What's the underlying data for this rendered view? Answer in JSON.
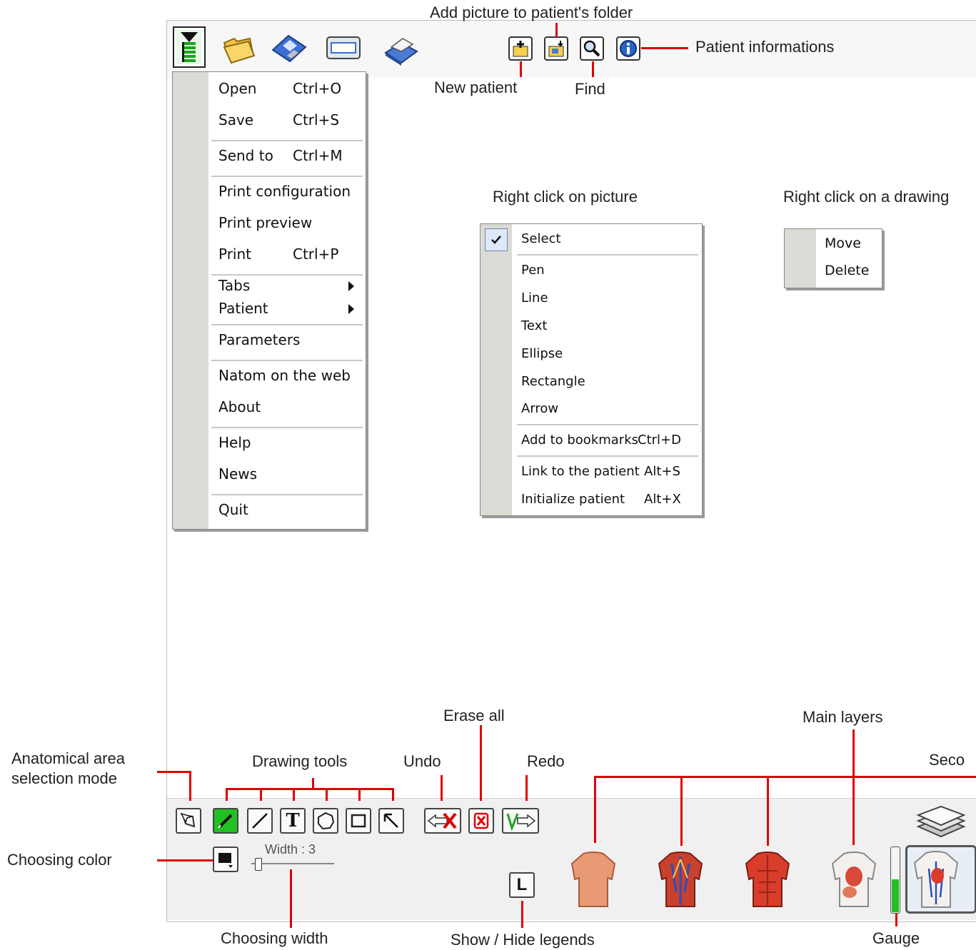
{
  "annotations": {
    "add_picture": "Add picture to patient's folder",
    "patient_info": "Patient informations",
    "new_patient": "New patient",
    "find": "Find",
    "right_click_picture": "Right click on picture",
    "right_click_drawing": "Right click on a drawing",
    "erase_all": "Erase all",
    "main_layers": "Main layers",
    "secondary_partial": "Seco",
    "anatomical_line1": "Anatomical area",
    "anatomical_line2": "selection mode",
    "drawing_tools": "Drawing tools",
    "undo": "Undo",
    "redo": "Redo",
    "choosing_color": "Choosing color",
    "choosing_width": "Choosing width",
    "show_hide_legends": "Show / Hide legends",
    "gauge": "Gauge"
  },
  "main_menu": {
    "items": [
      {
        "label": "Open",
        "shortcut": "Ctrl+O"
      },
      {
        "label": "Save",
        "shortcut": "Ctrl+S"
      },
      {
        "label": "Send to",
        "shortcut": "Ctrl+M"
      },
      {
        "label": "Print configuration",
        "shortcut": ""
      },
      {
        "label": "Print preview",
        "shortcut": ""
      },
      {
        "label": "Print",
        "shortcut": "Ctrl+P"
      },
      {
        "label": "Tabs",
        "shortcut": ""
      },
      {
        "label": "Patient",
        "shortcut": ""
      },
      {
        "label": "Parameters",
        "shortcut": ""
      },
      {
        "label": "Natom on the web",
        "shortcut": ""
      },
      {
        "label": "About",
        "shortcut": ""
      },
      {
        "label": "Help",
        "shortcut": ""
      },
      {
        "label": "News",
        "shortcut": ""
      },
      {
        "label": "Quit",
        "shortcut": ""
      }
    ]
  },
  "picture_menu": {
    "items": [
      {
        "label": "Select",
        "shortcut": "",
        "checked": true
      },
      {
        "label": "Pen",
        "shortcut": ""
      },
      {
        "label": "Line",
        "shortcut": ""
      },
      {
        "label": "Text",
        "shortcut": ""
      },
      {
        "label": "Ellipse",
        "shortcut": ""
      },
      {
        "label": "Rectangle",
        "shortcut": ""
      },
      {
        "label": "Arrow",
        "shortcut": ""
      },
      {
        "label": "Add to bookmarks",
        "shortcut": "Ctrl+D"
      },
      {
        "label": "Link to the patient",
        "shortcut": "Alt+S"
      },
      {
        "label": "Initialize patient",
        "shortcut": "Alt+X"
      }
    ]
  },
  "drawing_menu": {
    "items": [
      {
        "label": "Move"
      },
      {
        "label": "Delete"
      }
    ]
  },
  "width_control": {
    "label": "Width : 3",
    "value": 3
  },
  "legend_button": {
    "label": "L"
  },
  "text_tool": {
    "label": "T"
  },
  "gauge": {
    "fill_fraction": 0.5
  },
  "colors": {
    "accent_red": "#e00000",
    "selected_tool": "#22c022",
    "menu_gutter": "#dcdcd6"
  }
}
